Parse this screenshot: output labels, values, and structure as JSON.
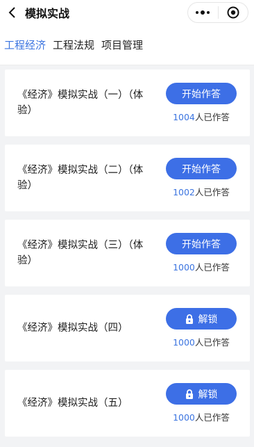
{
  "header": {
    "title": "模拟实战"
  },
  "tabs": [
    {
      "label": "工程经济",
      "active": true
    },
    {
      "label": "工程法规",
      "active": false
    },
    {
      "label": "项目管理",
      "active": false
    }
  ],
  "cards": [
    {
      "title": "《经济》模拟实战（一）（体验）",
      "button": "开始作答",
      "locked": false,
      "count": "1004",
      "count_suffix": "人已作答"
    },
    {
      "title": "《经济》模拟实战（二）（体验）",
      "button": "开始作答",
      "locked": false,
      "count": "1002",
      "count_suffix": "人已作答"
    },
    {
      "title": "《经济》模拟实战（三）（体验）",
      "button": "开始作答",
      "locked": false,
      "count": "1000",
      "count_suffix": "人已作答"
    },
    {
      "title": "《经济》模拟实战（四）",
      "button": "解锁",
      "locked": true,
      "count": "1000",
      "count_suffix": "人已作答"
    },
    {
      "title": "《经济》模拟实战（五）",
      "button": "解锁",
      "locked": true,
      "count": "1000",
      "count_suffix": "人已作答"
    }
  ],
  "colors": {
    "accent": "#3b74e0",
    "button": "#3d6fe6",
    "background": "#f2f3f5"
  },
  "icons": {
    "back": "chevron-left-icon",
    "more": "more-dots-icon",
    "close": "target-close-icon",
    "lock": "lock-icon"
  }
}
